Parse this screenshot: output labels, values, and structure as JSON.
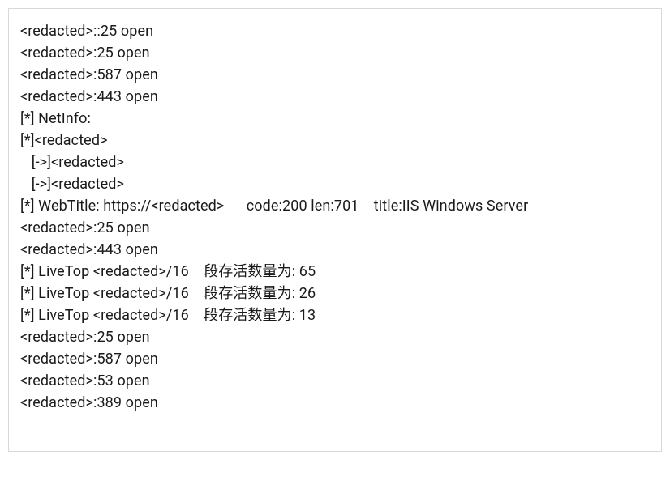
{
  "lines": [
    "<redacted>::25 open",
    "<redacted>:25 open",
    "<redacted>:587 open",
    "<redacted>:443 open",
    "[*] NetInfo:",
    "[*]<redacted>",
    "   [->]<redacted>",
    "   [->]<redacted>",
    "[*] WebTitle: https://<redacted>      code:200 len:701    title:IIS Windows Server",
    "<redacted>:25 open",
    "<redacted>:443 open",
    "[*] LiveTop <redacted>/16    段存活数量为: 65",
    "[*] LiveTop <redacted>/16    段存活数量为: 26",
    "[*] LiveTop <redacted>/16    段存活数量为: 13",
    "<redacted>:25 open",
    "<redacted>:587 open",
    "<redacted>:53 open",
    "<redacted>:389 open"
  ]
}
